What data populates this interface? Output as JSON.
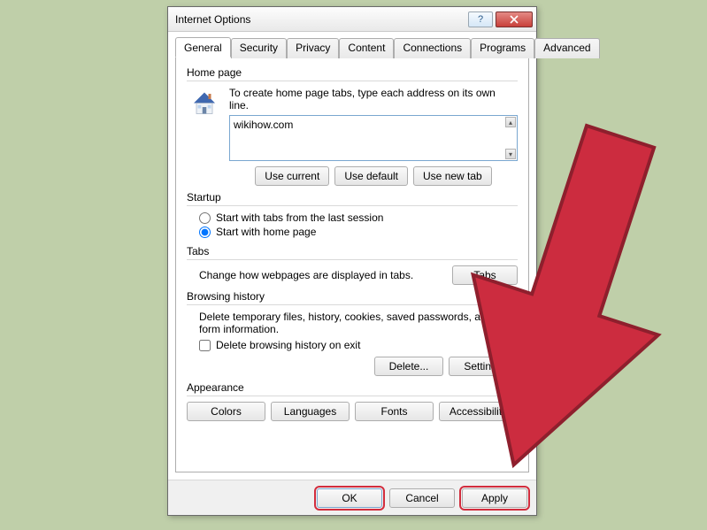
{
  "window": {
    "title": "Internet Options",
    "help_glyph": "?",
    "close_icon": "close-icon"
  },
  "tabs": {
    "items": [
      "General",
      "Security",
      "Privacy",
      "Content",
      "Connections",
      "Programs",
      "Advanced"
    ],
    "active_index": 0
  },
  "homepage": {
    "group_label": "Home page",
    "hint": "To create home page tabs, type each address on its own line.",
    "value": "wikihow.com",
    "use_current": "Use current",
    "use_default": "Use default",
    "use_new_tab": "Use new tab"
  },
  "startup": {
    "group_label": "Startup",
    "radio_last_session": "Start with tabs from the last session",
    "radio_home_page": "Start with home page",
    "selected": "home_page"
  },
  "tabs_section": {
    "group_label": "Tabs",
    "hint": "Change how webpages are displayed in tabs.",
    "button": "Tabs"
  },
  "browsing_history": {
    "group_label": "Browsing history",
    "hint": "Delete temporary files, history, cookies, saved passwords, and web form information.",
    "checkbox": "Delete browsing history on exit",
    "checked": false,
    "delete_button": "Delete...",
    "settings_button": "Settings"
  },
  "appearance": {
    "group_label": "Appearance",
    "colors": "Colors",
    "languages": "Languages",
    "fonts": "Fonts",
    "accessibility": "Accessibility"
  },
  "footer": {
    "ok": "OK",
    "cancel": "Cancel",
    "apply": "Apply"
  },
  "annotation": {
    "arrow_color": "#cc2c3f",
    "highlight_color": "#d22d3d"
  }
}
